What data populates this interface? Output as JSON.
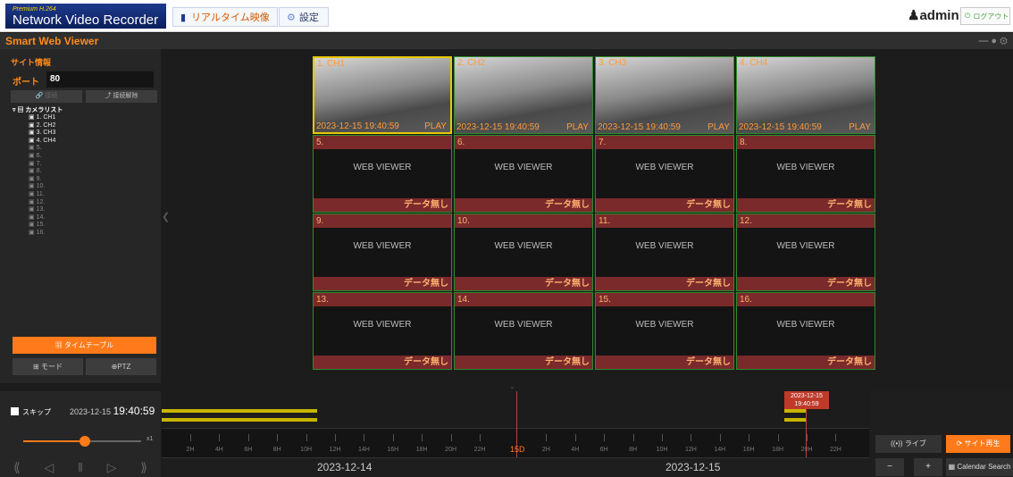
{
  "header": {
    "logo_small": "Premium H.264",
    "logo_title": "Network Video Recorder",
    "tab_live": "リアルタイム映像",
    "tab_settings": "設定",
    "user": "admin",
    "logout": "ログアウト"
  },
  "titlebar": {
    "title": "Smart Web Viewer"
  },
  "sidebar": {
    "section": "サイト情報",
    "port_label": "ポート",
    "port_value": "80",
    "connect_label": "接続",
    "disconnect_label": "接続解除",
    "tree_root": "カメラリスト",
    "cameras": [
      "1. CH1",
      "2. CH2",
      "3. CH3",
      "4. CH4",
      "5.",
      "6.",
      "7.",
      "8.",
      "9.",
      "10.",
      "11.",
      "12.",
      "13.",
      "14.",
      "15.",
      "16."
    ],
    "timetable": "タイムテーブル",
    "mode": "モード",
    "ptz": "PTZ"
  },
  "grid": {
    "cells": [
      {
        "label": "1. CH1",
        "ts": "2023-12-15 19:40:59",
        "state": "PLAY",
        "live": true
      },
      {
        "label": "2. CH2",
        "ts": "2023-12-15 19:40:59",
        "state": "PLAY",
        "live": true
      },
      {
        "label": "3. CH3",
        "ts": "2023-12-15 19:40:59",
        "state": "PLAY",
        "live": true
      },
      {
        "label": "4. CH4",
        "ts": "2023-12-15 19:40:59",
        "state": "PLAY",
        "live": true
      },
      {
        "label": "5.",
        "live": false
      },
      {
        "label": "6.",
        "live": false
      },
      {
        "label": "7.",
        "live": false
      },
      {
        "label": "8.",
        "live": false
      },
      {
        "label": "9.",
        "live": false
      },
      {
        "label": "10.",
        "live": false
      },
      {
        "label": "11.",
        "live": false
      },
      {
        "label": "12.",
        "live": false
      },
      {
        "label": "13.",
        "live": false
      },
      {
        "label": "14.",
        "live": false
      },
      {
        "label": "15.",
        "live": false
      },
      {
        "label": "16.",
        "live": false
      }
    ],
    "placeholder": "WEB VIEWER",
    "nodata": "データ無し"
  },
  "playback": {
    "skip_label": "スキップ",
    "date": "2023-12-15",
    "time": "19:40:59",
    "speed": "x1",
    "speed_level": 0.52
  },
  "timeline": {
    "hours": [
      "2H",
      "4H",
      "6H",
      "8H",
      "10H",
      "12H",
      "14H",
      "16H",
      "18H",
      "20H",
      "22H",
      "2H",
      "4H",
      "6H",
      "8H",
      "10H",
      "12H",
      "14H",
      "16H",
      "18H",
      "20H",
      "22H"
    ],
    "mid_label": "15D",
    "date_left": "2023-12-14",
    "date_right": "2023-12-15",
    "cursor_date": "2023-12-15",
    "cursor_time": "19:40:59"
  },
  "buttons": {
    "live": "ライブ",
    "site_play": "サイト再生",
    "minus": "−",
    "plus": "+",
    "calendar": "Calendar Search"
  },
  "colors": {
    "accent": "#ff7a1a",
    "live_border": "#2e8b2e",
    "selected_border": "#e6c800"
  }
}
